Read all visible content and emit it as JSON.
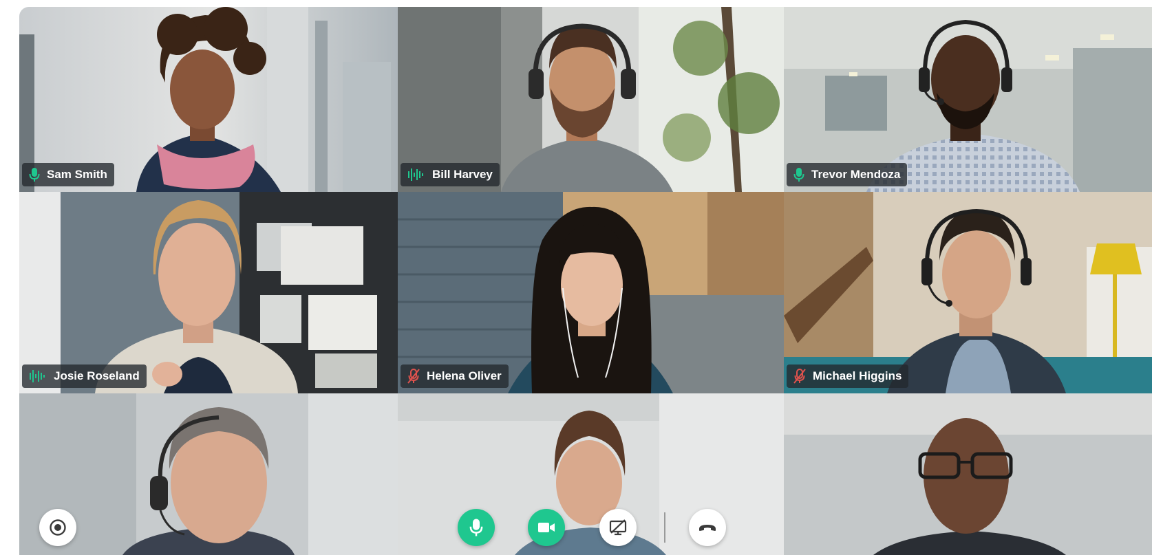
{
  "participants": [
    {
      "name": "Sam Smith",
      "audio": "mic-on",
      "icon": "microphone-icon"
    },
    {
      "name": "Bill Harvey",
      "audio": "speaking",
      "icon": "audio-wave-icon"
    },
    {
      "name": "Trevor Mendoza",
      "audio": "mic-on",
      "icon": "microphone-icon"
    },
    {
      "name": "Josie Roseland",
      "audio": "speaking",
      "icon": "audio-wave-icon"
    },
    {
      "name": "Helena Oliver",
      "audio": "muted",
      "icon": "microphone-muted-icon"
    },
    {
      "name": "Michael Higgins",
      "audio": "muted",
      "icon": "microphone-muted-icon"
    },
    {
      "name": "",
      "audio": "",
      "icon": ""
    },
    {
      "name": "",
      "audio": "",
      "icon": ""
    },
    {
      "name": "",
      "audio": "",
      "icon": ""
    }
  ],
  "controls": {
    "record": {
      "icon": "record-icon"
    },
    "microphone": {
      "icon": "microphone-icon"
    },
    "camera": {
      "icon": "video-camera-icon"
    },
    "screen_share": {
      "icon": "screen-share-off-icon"
    },
    "hang_up": {
      "icon": "phone-hangup-icon"
    }
  },
  "colors": {
    "accent_green": "#1fc78f",
    "muted_red": "#e0524d",
    "nameplate_bg": "#23282d"
  }
}
